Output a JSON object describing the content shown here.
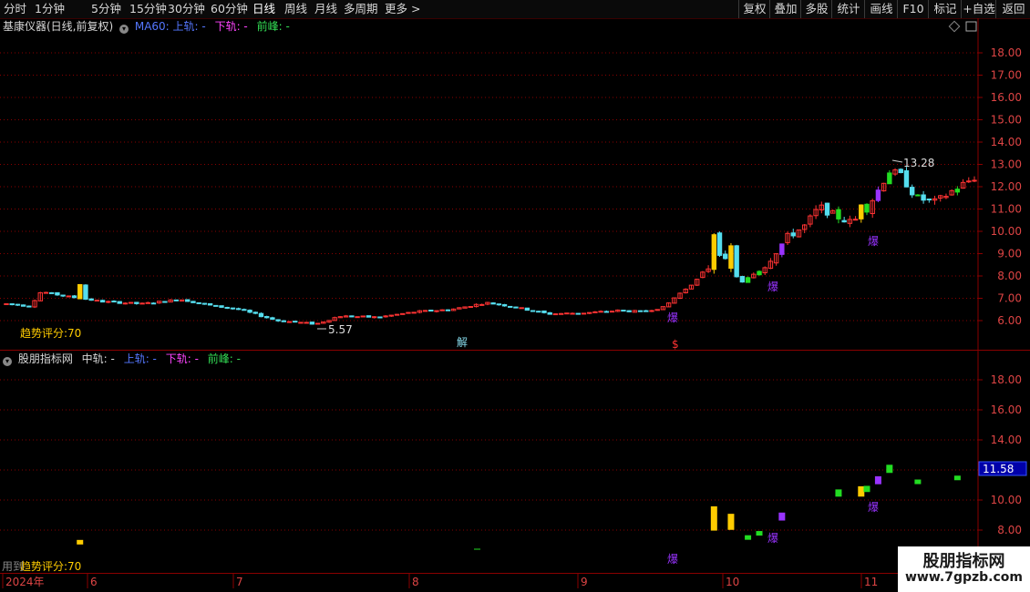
{
  "toolbar": {
    "periods": [
      "分时",
      "1分钟",
      "5分钟",
      "15分钟",
      "30分钟",
      "60分钟",
      "日线",
      "周线",
      "月线",
      "多周期",
      "更多 >"
    ],
    "active_period": "日线",
    "right": [
      "复权",
      "叠加",
      "多股",
      "统计",
      "画线",
      "F10",
      "标记",
      "+自选",
      "返回"
    ]
  },
  "main": {
    "title": "基康仪器(日线,前复权)",
    "ma_label": "MA60:",
    "upper_label": "上轨: -",
    "lower_label": "下轨: -",
    "peak_label": "前峰: -",
    "score_label": "趋势评分:70",
    "high_label": "13.28",
    "low_label": "5.57",
    "yticks": [
      "18.00",
      "17.00",
      "16.00",
      "15.00",
      "14.00",
      "13.00",
      "12.00",
      "11.00",
      "10.00",
      "9.00",
      "8.00",
      "7.00",
      "6.00"
    ],
    "markers": [
      "解",
      "$",
      "爆",
      "爆",
      "爆"
    ]
  },
  "sub": {
    "title": "股朋指标网",
    "mid_label": "中轨: -",
    "upper_label": "上轨: -",
    "lower_label": "下轨: -",
    "peak_label": "前峰: -",
    "score_label": "趋势评分:70",
    "yticks": [
      "18.00",
      "16.00",
      "14.00",
      "12.00",
      "10.00",
      "8.00"
    ],
    "current_value": "11.58",
    "markers": [
      "爆",
      "爆",
      "爆"
    ],
    "footer_text": "用到"
  },
  "xaxis": {
    "labels": [
      "2024年",
      "6",
      "7",
      "8",
      "9",
      "10",
      "11"
    ]
  },
  "logo": {
    "name": "股朋指标网",
    "url": "www.7gpzb.com"
  },
  "colors": {
    "up": "#ff3333",
    "down_cyan": "#55ddee",
    "strong_green": "#22dd22",
    "yellow": "#ffcc00",
    "purple": "#9933ff",
    "grid_red": "#8a0000",
    "axis_text": "#dd4444"
  },
  "chart_data": {
    "type": "candlestick",
    "y_range_main": [
      5.2,
      19.2
    ],
    "y_range_sub": [
      7.0,
      20.0
    ],
    "highlight_high": 13.28,
    "highlight_low": 5.57,
    "current_price": 11.58
  }
}
